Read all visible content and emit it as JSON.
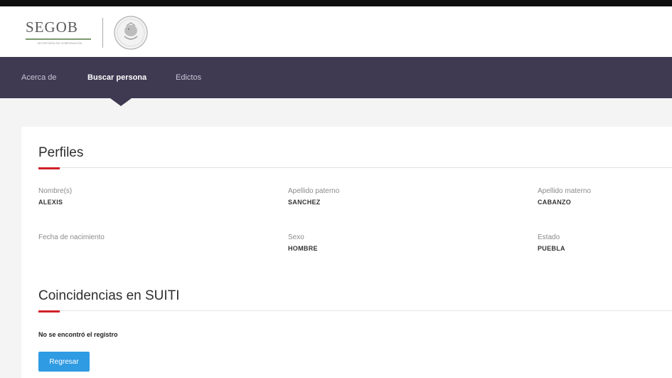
{
  "header": {
    "logo_text": "SEGOB",
    "logo_subtitle": "SECRETARÍA DE GOBERNACIÓN"
  },
  "nav": {
    "items": [
      {
        "label": "Acerca de",
        "active": false
      },
      {
        "label": "Buscar persona",
        "active": true
      },
      {
        "label": "Edictos",
        "active": false
      }
    ]
  },
  "profile": {
    "title": "Perfiles",
    "fields": [
      {
        "label": "Nombre(s)",
        "value": "ALEXIS"
      },
      {
        "label": "Apellido paterno",
        "value": "SANCHEZ"
      },
      {
        "label": "Apellido materno",
        "value": "CABANZO"
      },
      {
        "label": "Fecha de nacimiento",
        "value": ""
      },
      {
        "label": "Sexo",
        "value": "HOMBRE"
      },
      {
        "label": "Estado",
        "value": "PUEBLA"
      }
    ]
  },
  "matches": {
    "title": "Coincidencias en SUITI",
    "message": "No se encontró el registro",
    "back_label": "Regresar"
  },
  "colors": {
    "navbar": "#3f3a52",
    "accent": "#d0212b",
    "button": "#2f9be3"
  }
}
